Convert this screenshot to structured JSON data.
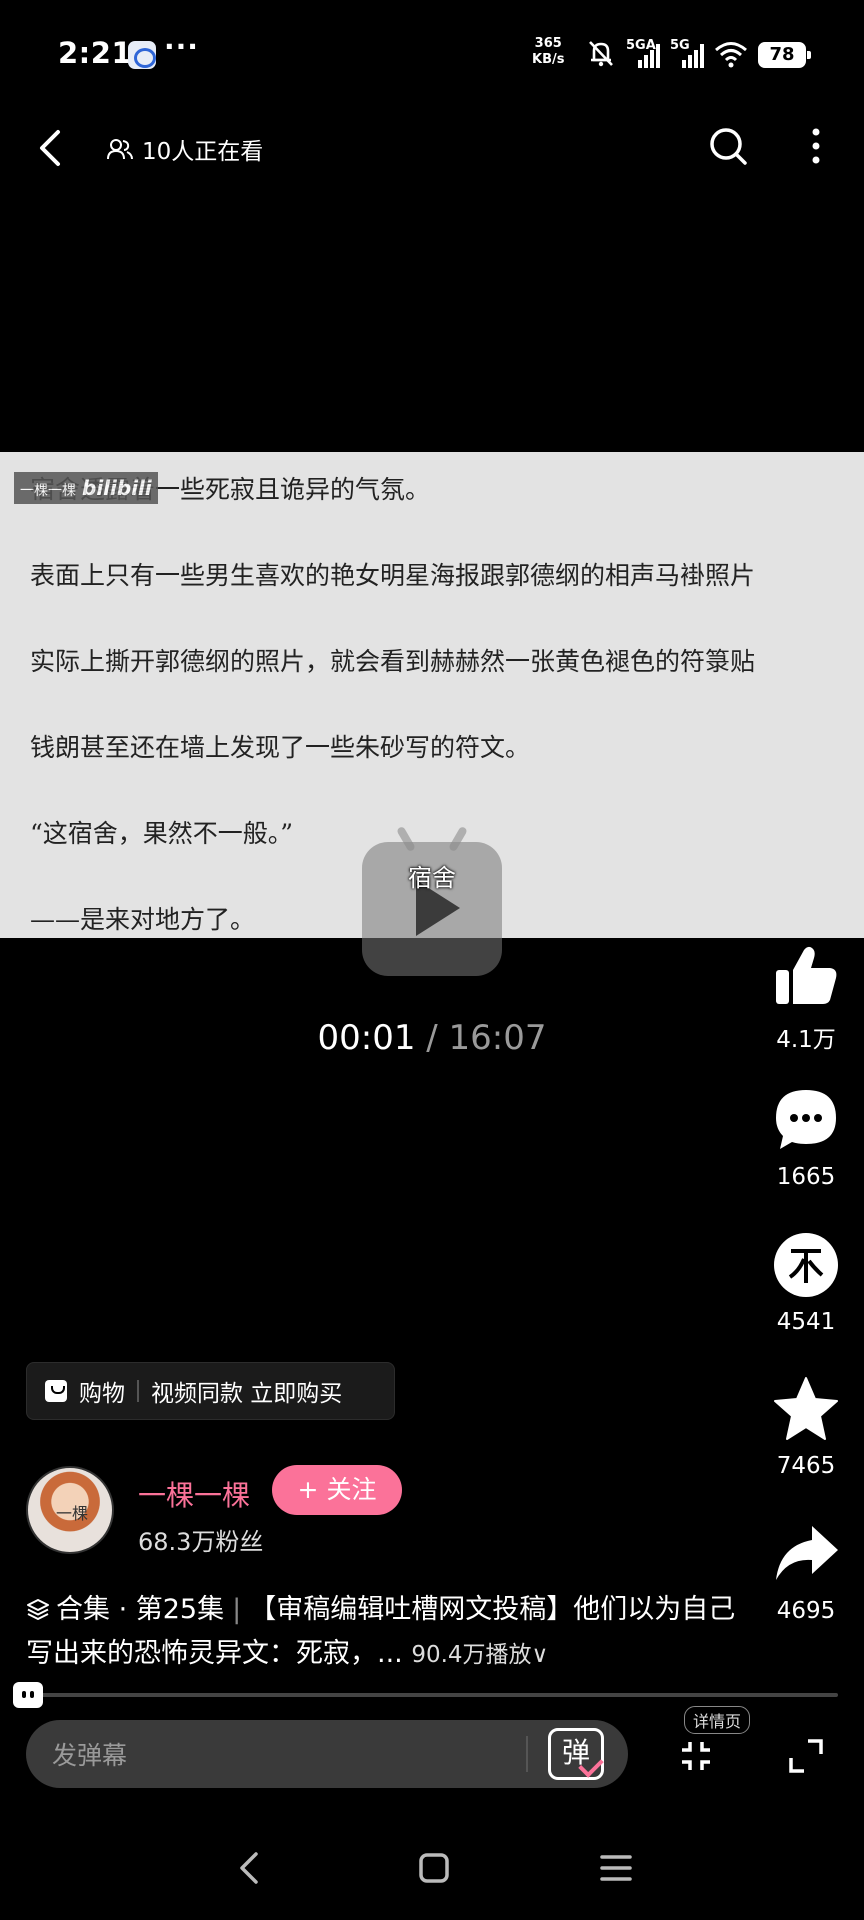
{
  "status_bar": {
    "time": "2:21",
    "more": "···",
    "net_speed_value": "365",
    "net_speed_unit": "KB/s",
    "sim1_label": "5GA",
    "sim2_label": "5G",
    "battery": "78"
  },
  "top_nav": {
    "watchers": "10人正在看"
  },
  "video": {
    "watermark_name": "一棵一棵",
    "watermark_brand": "bilibili",
    "lines": [
      "宿舍透露着一些死寂且诡异的气氛。",
      "表面上只有一些男生喜欢的艳女明星海报跟郭德纲的相声马褂照片",
      "实际上撕开郭德纲的照片，就会看到赫赫然一张黄色褪色的符箓贴",
      "钱朗甚至还在墙上发现了一些朱砂写的符文。",
      "“这宿舍，果然不一般。”",
      "——是来对地方了。"
    ],
    "subtitle": "宿舍"
  },
  "playback": {
    "current": "00:01",
    "separator": " / ",
    "total": "16:07",
    "progress": 0.001
  },
  "actions": {
    "like_count": "4.1万",
    "comment_count": "1665",
    "coin_count": "4541",
    "favorite_count": "7465",
    "share_count": "4695"
  },
  "shop": {
    "label": "购物",
    "promo": "视频同款 立即购买"
  },
  "uploader": {
    "avatar_text": "一棵",
    "name": "一棵一棵",
    "follow_label": "+ 关注",
    "fans": "68.3万粉丝"
  },
  "description": {
    "collection": "合集 · 第25集",
    "separator": "|",
    "title": "【审稿编辑吐槽网文投稿】他们以为自己写出来的恐怖灵异文：死寂，...",
    "plays": "90.4万播放∨"
  },
  "bottom": {
    "danmaku_placeholder": "发弹幕",
    "danmaku_toggle": "弹",
    "detail_label": "详情页"
  },
  "colors": {
    "accent": "#fb7299",
    "background": "#000000"
  }
}
